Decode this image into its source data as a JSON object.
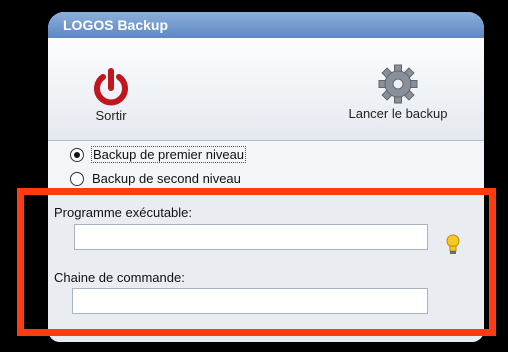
{
  "window": {
    "title": "LOGOS Backup"
  },
  "toolbar": {
    "exit_label": "Sortir",
    "exit_icon": "power-icon",
    "run_label": "Lancer le backup",
    "run_icon": "gear-icon"
  },
  "options": {
    "level_1": "Backup de premier niveau",
    "level_2": "Backup de second niveau",
    "selected": "level_1"
  },
  "fields": {
    "exe_label": "Programme exécutable:",
    "exe_value": "",
    "hint_icon": "lightbulb-icon",
    "cmd_label": "Chaine de commande:",
    "cmd_value": ""
  },
  "colors": {
    "title_bar": "#5d87c2",
    "highlight": "#ff3b14",
    "power_icon": "#c0161e"
  }
}
